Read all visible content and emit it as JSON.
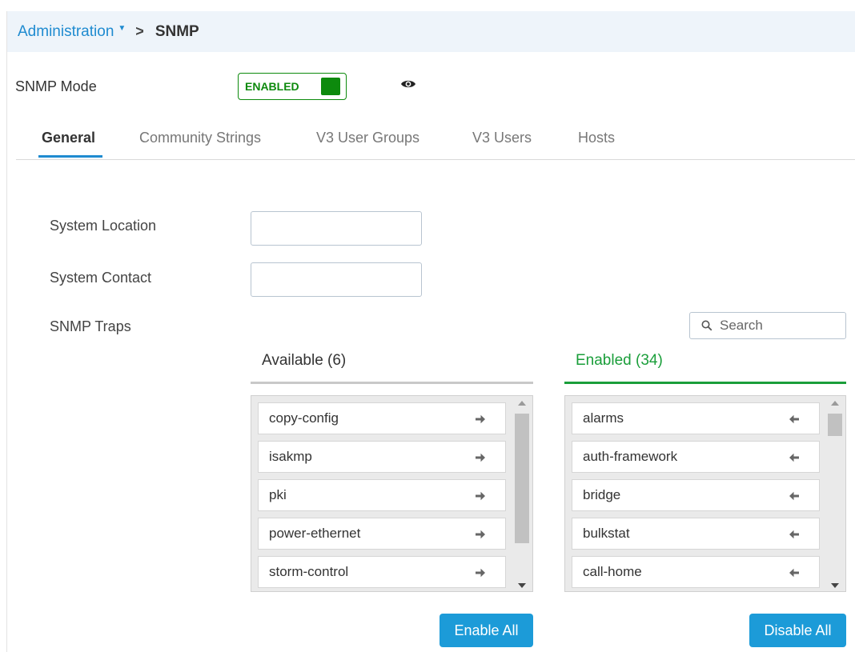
{
  "breadcrumb": {
    "parent": "Administration",
    "current": "SNMP"
  },
  "snmp_mode": {
    "label": "SNMP Mode",
    "toggle_text": "ENABLED",
    "enabled": true,
    "accent_color": "#0d8a0d"
  },
  "tabs": [
    {
      "label": "General",
      "active": true
    },
    {
      "label": "Community Strings",
      "active": false
    },
    {
      "label": "V3 User Groups",
      "active": false
    },
    {
      "label": "V3 Users",
      "active": false
    },
    {
      "label": "Hosts",
      "active": false
    }
  ],
  "form": {
    "system_location": {
      "label": "System Location",
      "value": ""
    },
    "system_contact": {
      "label": "System Contact",
      "value": ""
    },
    "snmp_traps_label": "SNMP Traps"
  },
  "search": {
    "placeholder": "Search"
  },
  "available": {
    "header": "Available (6)",
    "items": [
      "copy-config",
      "isakmp",
      "pki",
      "power-ethernet",
      "storm-control"
    ],
    "action_icon": "arrow-right-icon",
    "button": "Enable All"
  },
  "enabled": {
    "header": "Enabled (34)",
    "header_color": "#1a9e3a",
    "items": [
      "alarms",
      "auth-framework",
      "bridge",
      "bulkstat",
      "call-home"
    ],
    "action_icon": "arrow-left-icon",
    "button": "Disable All"
  },
  "colors": {
    "link": "#1f8bd0",
    "button": "#1c9bd8",
    "enabled_green": "#0d8a0d"
  }
}
